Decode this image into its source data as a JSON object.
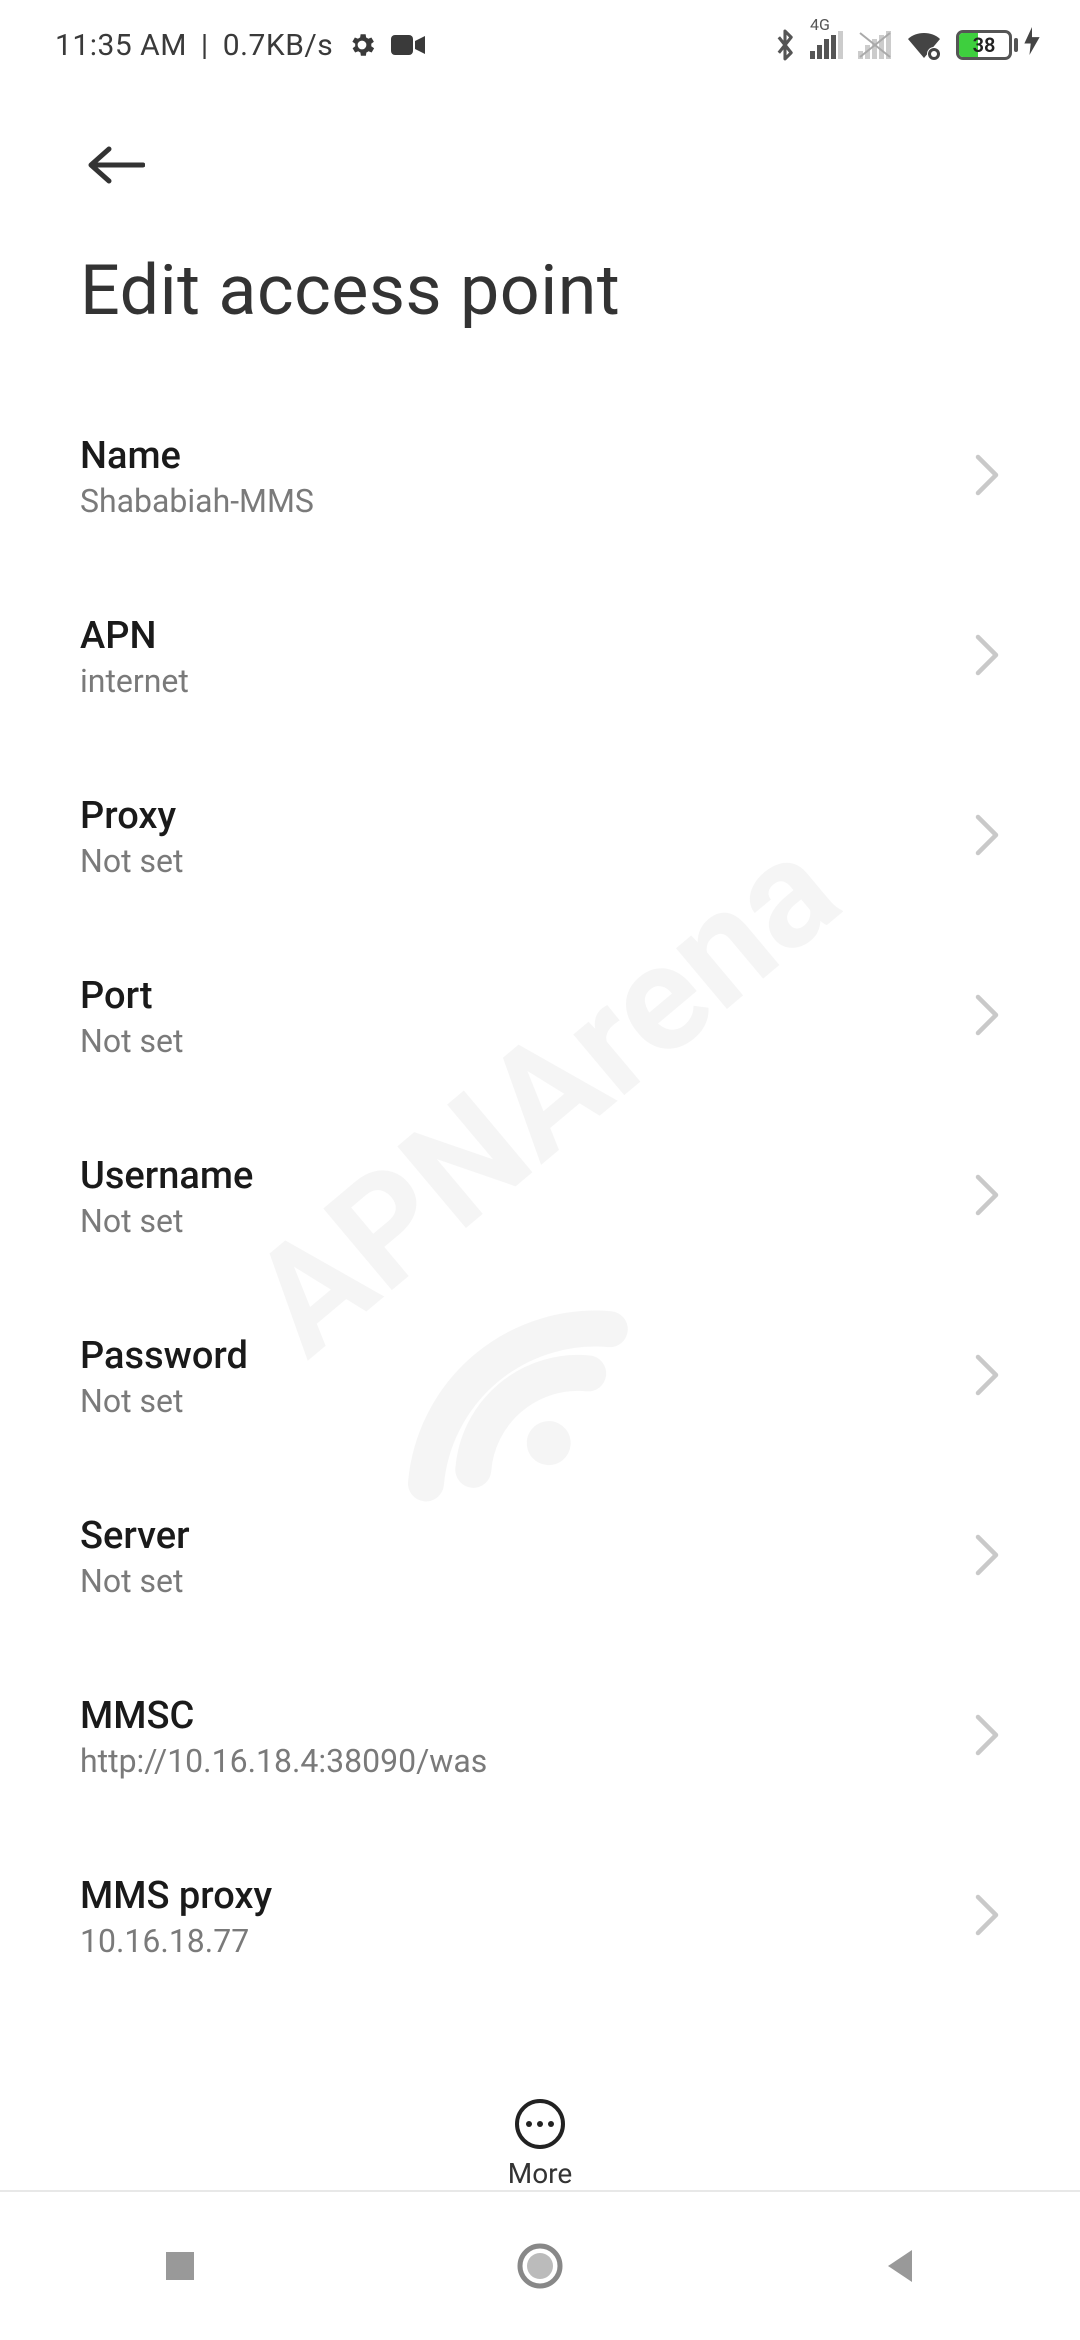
{
  "statusbar": {
    "time": "11:35 AM",
    "separator": "|",
    "data_rate": "0.7KB/s",
    "network_label": "4G",
    "battery_percent": "38"
  },
  "header": {
    "title": "Edit access point"
  },
  "settings": [
    {
      "label": "Name",
      "value": "Shababiah-MMS"
    },
    {
      "label": "APN",
      "value": "internet"
    },
    {
      "label": "Proxy",
      "value": "Not set"
    },
    {
      "label": "Port",
      "value": "Not set"
    },
    {
      "label": "Username",
      "value": "Not set"
    },
    {
      "label": "Password",
      "value": "Not set"
    },
    {
      "label": "Server",
      "value": "Not set"
    },
    {
      "label": "MMSC",
      "value": "http://10.16.18.4:38090/was"
    },
    {
      "label": "MMS proxy",
      "value": "10.16.18.77"
    }
  ],
  "bottom": {
    "more_label": "More"
  },
  "watermark": {
    "text": "APNArena"
  }
}
